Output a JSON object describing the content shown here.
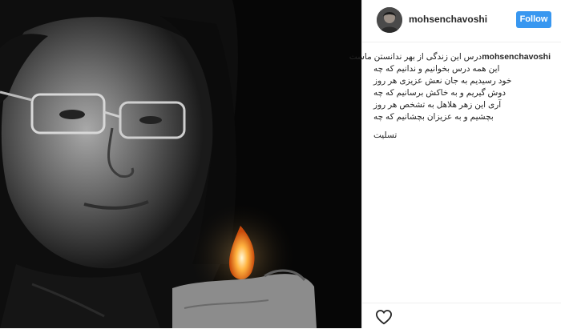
{
  "post": {
    "username": "mohsenchavoshi",
    "follow_label": "Follow",
    "caption_user": "mohsenchavoshi",
    "caption_lines": [
      "درس این زندگی از بهر ندانستن ماست",
      "این همه درس بخوانیم و ندانیم که چه",
      "خود رسیدیم به جان نعش عزیزی هر روز",
      "دوش گیریم و به خاکش برسانیم که چه",
      "آری این زهر هلاهل به تشخص هر روز",
      "بچشیم و به عزیزان بچشانیم که چه"
    ],
    "signature": "تسلیت"
  },
  "icons": {
    "like": "heart-outline-icon"
  },
  "colors": {
    "follow_button": "#3897f0",
    "text": "#262626",
    "divider": "#efefef"
  }
}
